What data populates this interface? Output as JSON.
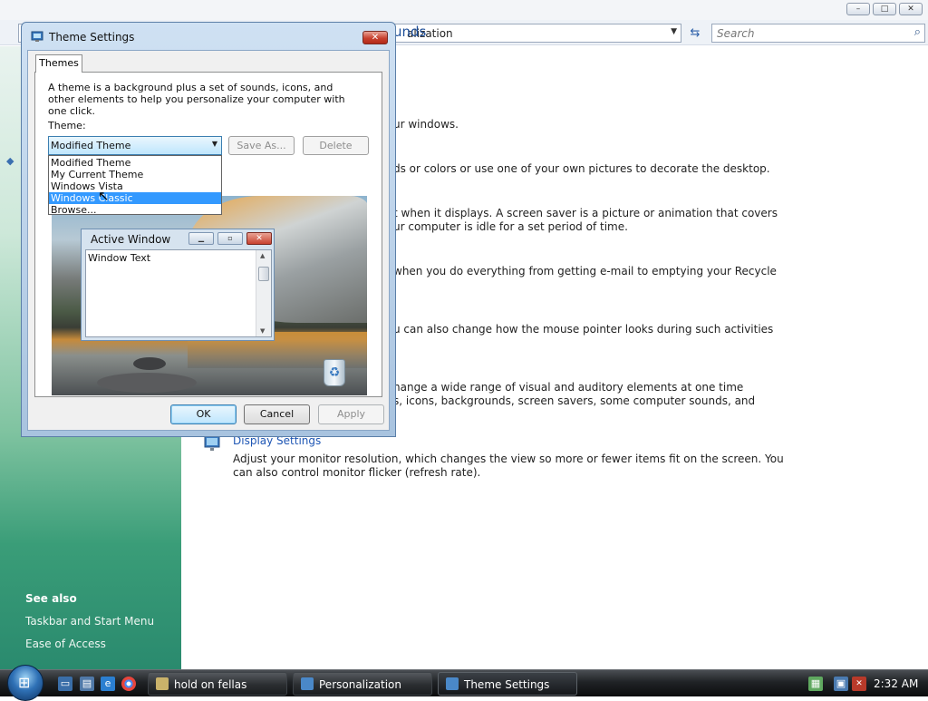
{
  "background_window": {
    "address_text": "alization",
    "search_placeholder": "Search",
    "heading_fragment": "unds",
    "window_controls": {
      "minimize": "–",
      "maximize": "□",
      "close": "✕"
    },
    "main_lines": [
      "ur windows.",
      "ds or colors or use one of your own pictures to decorate the desktop.",
      "t when it displays. A screen saver is a picture or animation that covers",
      "ur computer is idle for a set period of time.",
      "when you do everything from getting e-mail to emptying your Recycle",
      "u can also change how the mouse pointer looks during such activities",
      "hange a wide range of visual and auditory elements at one time",
      "s, icons, backgrounds, screen savers, some computer sounds, and"
    ],
    "display_settings": {
      "label": "Display Settings",
      "desc_line1": "Adjust your monitor resolution, which changes the view so more or fewer items fit on the screen. You",
      "desc_line2": "can also control monitor flicker (refresh rate)."
    },
    "sidebar": {
      "see_also": "See also",
      "links": [
        "Taskbar and Start Menu",
        "Ease of Access"
      ]
    }
  },
  "dialog": {
    "title": "Theme Settings",
    "tab": "Themes",
    "description": "A theme is a background plus a set of sounds, icons, and other elements to help you personalize your computer with one click.",
    "theme_label": "Theme:",
    "theme_value": "Modified Theme",
    "save_as": "Save As...",
    "delete": "Delete",
    "dropdown_options": [
      "Modified Theme",
      "My Current Theme",
      "Windows Vista",
      "Windows Classic",
      "Browse..."
    ],
    "dropdown_selected": "Windows Classic",
    "preview": {
      "window_title": "Active Window",
      "window_text": "Window Text"
    },
    "ok": "OK",
    "cancel": "Cancel",
    "apply": "Apply"
  },
  "taskbar": {
    "tasks": [
      {
        "label": "hold on fellas",
        "active": false
      },
      {
        "label": "Personalization",
        "active": false
      },
      {
        "label": "Theme Settings",
        "active": true
      }
    ],
    "clock": "2:32 AM"
  }
}
